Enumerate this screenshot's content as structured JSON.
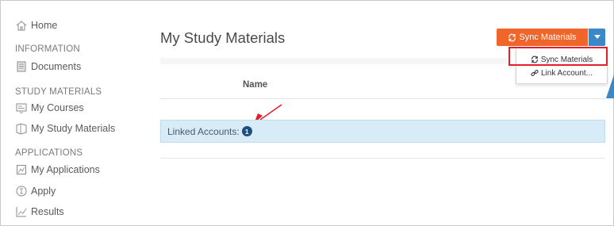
{
  "sidebar": {
    "home": "Home",
    "sections": {
      "information": "INFORMATION",
      "study_materials": "STUDY MATERIALS",
      "applications": "APPLICATIONS"
    },
    "items": {
      "documents": "Documents",
      "my_courses": "My Courses",
      "my_study_materials": "My Study Materials",
      "my_applications": "My Applications",
      "apply": "Apply",
      "results": "Results"
    }
  },
  "main": {
    "title": "My Study Materials",
    "sync_button_label": "Sync Materials",
    "dropdown": {
      "sync_materials": "Sync Materials",
      "link_account": "Link Account..."
    },
    "table": {
      "name_header": "Name"
    },
    "linked_accounts": {
      "label": "Linked Accounts:",
      "count": "1"
    }
  },
  "colors": {
    "sync_button": "#f0652a",
    "caret_button": "#3a88c8",
    "annotation": "#e0202a",
    "linked_row_bg": "#d7ecf6",
    "badge": "#1d4f82"
  },
  "icons": [
    "home-icon",
    "documents-icon",
    "courses-icon",
    "study-materials-icon",
    "applications-icon",
    "apply-icon",
    "results-icon",
    "sync-icon",
    "link-icon",
    "caret-down-icon"
  ]
}
